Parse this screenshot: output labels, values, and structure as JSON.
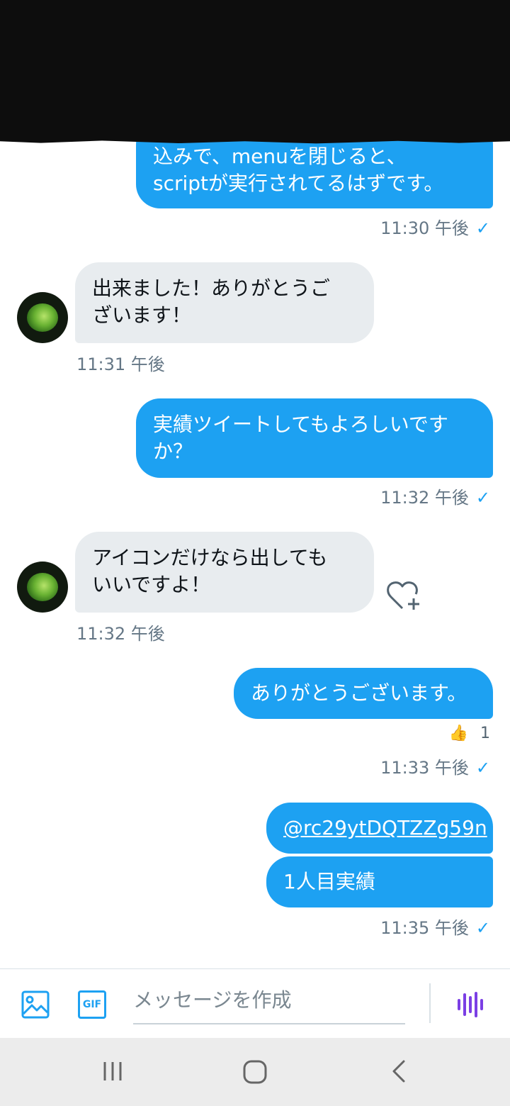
{
  "messages": {
    "m1": {
      "line1": "込みで、menuを閉じると、",
      "line2": "scriptが実行されてるはずです。",
      "time": "11:30 午後"
    },
    "m2": {
      "line1": "出来ました！ありがとうご",
      "line2": "ざいます！",
      "time": "11:31 午後"
    },
    "m3": {
      "line1": "実績ツイートしてもよろしいです",
      "line2": "か？",
      "time": "11:32 午後"
    },
    "m4": {
      "line1": "アイコンだけなら出しても",
      "line2": "いいですよ！",
      "time": "11:32 午後"
    },
    "m5": {
      "text": "ありがとうございます。",
      "reaction_emoji": "👍",
      "reaction_count": "1",
      "time": "11:33 午後"
    },
    "m6": {
      "link": "@rc29ytDQTZZg59n",
      "text": "1人目実績",
      "time": "11:35 午後"
    }
  },
  "read_tick": "✓",
  "composer": {
    "placeholder": "メッセージを作成",
    "gif_label": "GIF"
  },
  "icons": [
    "image-icon",
    "gif-icon",
    "voice-message-icon",
    "add-reaction-heart-icon",
    "recent-apps-icon",
    "home-icon",
    "back-icon"
  ],
  "colors": {
    "accent": "#1da1f2",
    "incoming_bubble": "#e8ecef",
    "voice": "#7b3fe4"
  }
}
